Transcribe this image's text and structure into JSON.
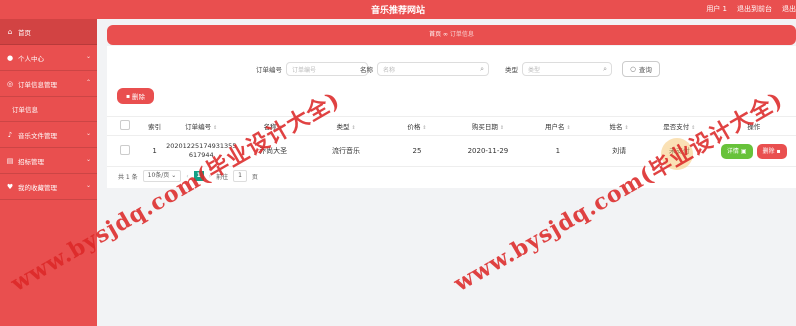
{
  "header": {
    "site_title": "音乐推荐网站",
    "user_label": "用户 1",
    "back_label": "退出到前台",
    "logout_label": "退出"
  },
  "sidebar": {
    "items": [
      {
        "label": "首页",
        "icon": "home-icon"
      },
      {
        "label": "个人中心",
        "icon": "user-icon"
      },
      {
        "label": "订单信息管理",
        "icon": "order-icon"
      },
      {
        "label": "订单信息",
        "icon": ""
      },
      {
        "label": "音乐文件管理",
        "icon": "music-icon"
      },
      {
        "label": "招标管理",
        "icon": "bid-icon"
      },
      {
        "label": "我的收藏管理",
        "icon": "heart-icon"
      }
    ]
  },
  "breadcrumb": {
    "home": "首页",
    "sep": "∞",
    "current": "订单信息"
  },
  "search": {
    "order_no_label": "订单编号",
    "order_no_placeholder": "订单编号",
    "name_label": "名称",
    "name_placeholder": "名称",
    "type_label": "类型",
    "type_placeholder": "类型",
    "search_button": "查询"
  },
  "delete_button": "删除",
  "table": {
    "headers": [
      "索引",
      "订单编号",
      "名称",
      "类型",
      "价格",
      "购买日期",
      "用户名",
      "姓名",
      "是否支付",
      "操作"
    ],
    "rows": [
      {
        "index": "1",
        "order_no_line1": "20201225174931355",
        "order_no_line2": "617944",
        "name": "乔尚大圣",
        "type": "流行音乐",
        "price": "25",
        "date": "2020-11-29",
        "username": "1",
        "fullname": "刘请",
        "paid": "未支付",
        "detail": "详情",
        "delete": "删除"
      }
    ]
  },
  "pager": {
    "total": "共 1 条",
    "page_size": "10条/页",
    "current_page": "1",
    "goto": "前往",
    "goto_value": "1",
    "page_unit": "页"
  },
  "watermark": {
    "text1": "www.bysjdq.com(毕业设计大全)",
    "text2": "www.bysjdq.com(毕业设计大全)"
  },
  "colors": {
    "brand": "#e94f4f",
    "success": "#67c23a",
    "pager": "#14a085"
  }
}
